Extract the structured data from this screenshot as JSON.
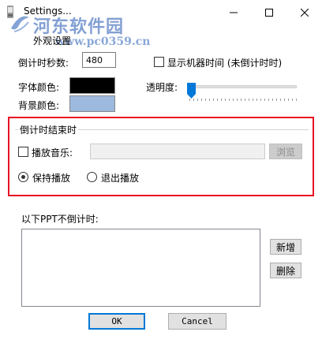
{
  "window": {
    "title": "Settings...",
    "minimize_glyph": "—",
    "maximize_glyph": "☐",
    "close_glyph": "✕"
  },
  "watermark": {
    "name": "河东软件园",
    "url": "www.pc0359.cn"
  },
  "appearance": {
    "section_title": "外观设置",
    "countdown_seconds_label": "倒计时秒数:",
    "countdown_seconds_value": "480",
    "show_clock_label": "显示机器时间 (未倒计时时)",
    "show_clock_checked": false,
    "font_color_label": "字体颜色:",
    "font_color": "#000000",
    "background_color_label": "背景颜色:",
    "background_color": "#9db9de",
    "transparency_label": "透明度:",
    "transparency_value": 0
  },
  "countdown_end": {
    "group_title": "倒计时结束时",
    "play_music_label": "播放音乐:",
    "play_music_checked": false,
    "music_path_value": "",
    "browse_label": "浏览",
    "keep_playing_label": "保持播放",
    "exit_playing_label": "退出播放",
    "selected_option": "keep_playing"
  },
  "exclusions": {
    "label": "以下PPT不倒计时:",
    "items": [],
    "add_label": "新增",
    "delete_label": "删除"
  },
  "footer": {
    "ok_label": "OK",
    "cancel_label": "Cancel"
  }
}
